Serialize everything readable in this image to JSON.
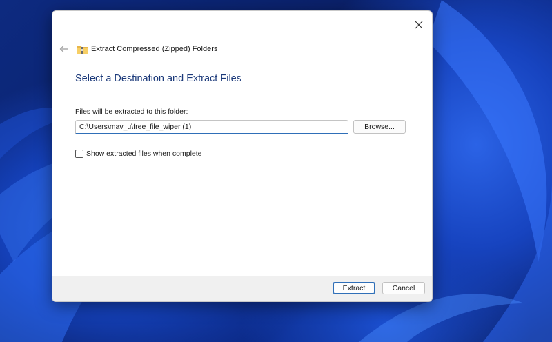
{
  "wizard": {
    "title": "Extract Compressed (Zipped) Folders",
    "heading": "Select a Destination and Extract Files",
    "folder_label": "Files will be extracted to this folder:",
    "path_value": "C:\\Users\\mav_u\\free_file_wiper (1)",
    "browse_label": "Browse...",
    "show_files_label": "Show extracted files when complete",
    "show_files_checked": false,
    "extract_label": "Extract",
    "cancel_label": "Cancel"
  },
  "icons": {
    "close": "close-icon",
    "back": "back-arrow-icon",
    "folder": "zipped-folder-icon"
  },
  "colors": {
    "heading": "#1c3a7a",
    "accent": "#2f6fb8",
    "wallpaper": "#1440b8"
  }
}
